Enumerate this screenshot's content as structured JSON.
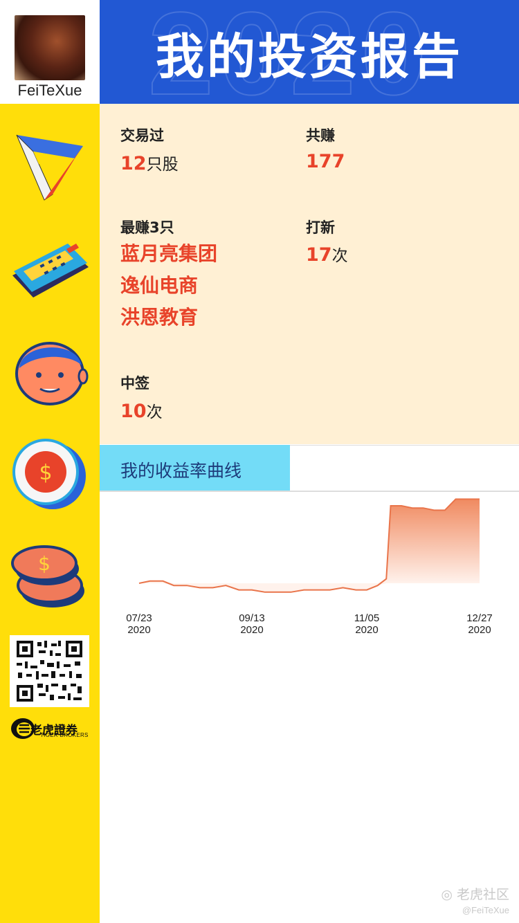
{
  "user": {
    "name": "FeiTeXue"
  },
  "header": {
    "title": "我的投资报告",
    "year": "2020"
  },
  "stats": {
    "traded_label": "交易过",
    "traded_value": "12",
    "traded_unit": "只股",
    "earned_label": "共赚",
    "earned_value": "177",
    "top3_label": "最赚3只",
    "top3": [
      "蓝月亮集团",
      "逸仙电商",
      "洪恩教育"
    ],
    "ipo_label": "打新",
    "ipo_value": "17",
    "ipo_unit": "次",
    "won_label": "中签",
    "won_value": "10",
    "won_unit": "次"
  },
  "chart_section": {
    "tab_label": "我的收益率曲线"
  },
  "chart_data": {
    "type": "area",
    "title": "",
    "xlabel": "",
    "ylabel": "",
    "x_ticks": [
      {
        "date": "07/23",
        "year": "2020"
      },
      {
        "date": "09/13",
        "year": "2020"
      },
      {
        "date": "11/05",
        "year": "2020"
      },
      {
        "date": "12/27",
        "year": "2020"
      }
    ],
    "x": [
      "2020-07-23",
      "2020-07-28",
      "2020-08-03",
      "2020-08-08",
      "2020-08-14",
      "2020-08-20",
      "2020-08-26",
      "2020-09-01",
      "2020-09-07",
      "2020-09-13",
      "2020-09-19",
      "2020-09-25",
      "2020-10-01",
      "2020-10-07",
      "2020-10-13",
      "2020-10-19",
      "2020-10-25",
      "2020-10-31",
      "2020-11-05",
      "2020-11-10",
      "2020-11-14",
      "2020-11-16",
      "2020-11-21",
      "2020-11-26",
      "2020-12-01",
      "2020-12-06",
      "2020-12-11",
      "2020-12-16",
      "2020-12-21",
      "2020-12-27"
    ],
    "values": [
      0,
      1,
      1,
      -1,
      -1,
      -2,
      -2,
      -1,
      -3,
      -3,
      -4,
      -4,
      -4,
      -3,
      -3,
      -3,
      -2,
      -3,
      -3,
      -1,
      2,
      35,
      35,
      34,
      34,
      33,
      33,
      38,
      38,
      38
    ],
    "grid": false,
    "legend": "none",
    "colors": {
      "line": "#e9744a",
      "fill_top": "#f08a60",
      "fill_bottom": "#fff2ec"
    }
  },
  "brand": {
    "name": "老虎證券",
    "sub": "TIGER BROKERS"
  },
  "watermark": {
    "text": "老虎社区",
    "sub": "@FeiTeXue"
  },
  "icons": [
    "penrose-triangle-icon",
    "calculator-icon",
    "face-icon",
    "dollar-clock-icon",
    "coins-icon",
    "qr-code-icon",
    "tiger-logo-icon"
  ],
  "colors": {
    "sidebar": "#ffde0a",
    "header": "#2258d3",
    "panel": "#fff0d4",
    "accent": "#e8432a",
    "tab": "#73dcf7"
  }
}
